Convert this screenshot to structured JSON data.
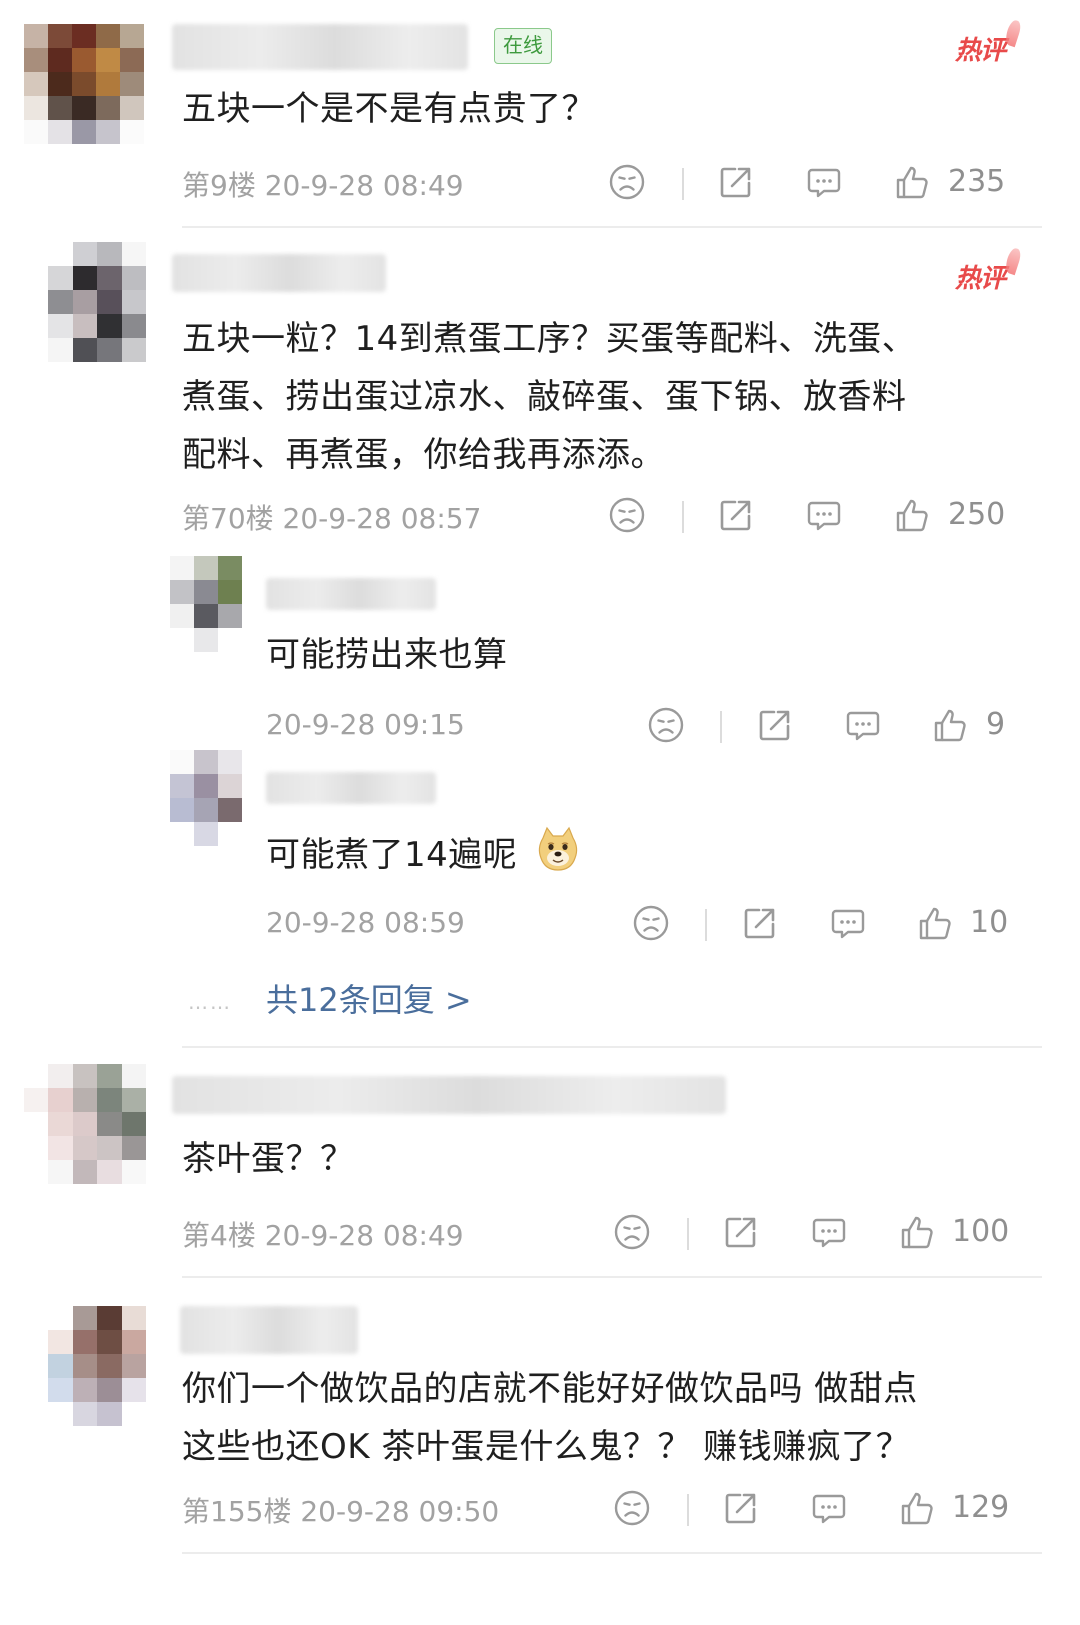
{
  "comments": [
    {
      "text_lines": [
        "五块一个是不是有点贵了？"
      ],
      "floor": "第9楼",
      "timestamp": "20-9-28 08:49",
      "likes": "235",
      "online_badge": "在线",
      "hot_badge": "热评"
    },
    {
      "text_lines": [
        "五块一粒？14到煮蛋工序？买蛋等配料、洗蛋、",
        "煮蛋、捞出蛋过凉水、敲碎蛋、蛋下锅、放香料",
        "配料、再煮蛋，你给我再添添。"
      ],
      "floor": "第70楼",
      "timestamp": "20-9-28 08:57",
      "likes": "250",
      "hot_badge": "热评",
      "replies": [
        {
          "text": "可能捞出来也算",
          "timestamp": "20-9-28 09:15",
          "likes": "9"
        },
        {
          "text": "可能煮了14遍呢",
          "emoji": "doge-emoji",
          "timestamp": "20-9-28 08:59",
          "likes": "10"
        }
      ],
      "more_replies": "共12条回复 >",
      "more_dots": "……"
    },
    {
      "text_lines": [
        "茶叶蛋？？"
      ],
      "floor": "第4楼",
      "timestamp": "20-9-28 08:49",
      "likes": "100"
    },
    {
      "text_lines": [
        "你们一个做饮品的店就不能好好做饮品吗 做甜点",
        "这些也还OK 茶叶蛋是什么鬼？？ 赚钱赚疯了？"
      ],
      "floor": "第155楼",
      "timestamp": "20-9-28 09:50",
      "likes": "129"
    }
  ],
  "icons": {
    "dislike": "sad-face-icon",
    "share": "share-icon",
    "reply": "comment-icon",
    "like": "thumbs-up-icon"
  },
  "colors": {
    "text": "#1f1f1f",
    "meta": "#a2a2a2",
    "hot": "#e84a4a",
    "link": "#4a6e9c",
    "online": "#3e9a3e"
  }
}
